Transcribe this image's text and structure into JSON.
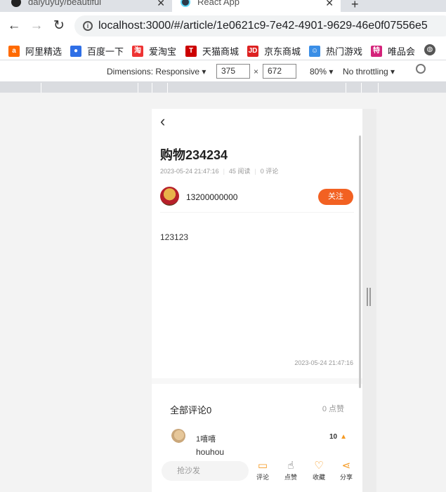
{
  "browser": {
    "tabs": [
      {
        "title": "daiyuyuy/beautiful",
        "icon": "github-icon"
      },
      {
        "title": "React App",
        "icon": "react-icon"
      }
    ],
    "url_host": "localhost",
    "url_rest": ":3000/#/article/1e0621c9-7e42-4901-9629-46e0f07556e5",
    "bookmarks": [
      "阿里精选",
      "百度一下",
      "爱淘宝",
      "天猫商城",
      "京东商城",
      "热门游戏",
      "唯品会"
    ]
  },
  "devtools": {
    "dimensions_label": "Dimensions: Responsive",
    "width": "375",
    "height": "672",
    "zoom": "80%",
    "throttling": "No throttling"
  },
  "article": {
    "title": "购物234234",
    "date": "2023-05-24 21:47:16",
    "reads": "45 阅读",
    "comments_count": "0 评论",
    "author": "13200000000",
    "follow_label": "关注",
    "content": "123123",
    "publish_time": "2023-05-24 21:47:16"
  },
  "comments_section": {
    "title": "全部评论0",
    "likes_total": "0 点赞",
    "items": [
      {
        "name": "1嘻嘻",
        "likes": "10",
        "text": "houhou"
      }
    ]
  },
  "bottom_bar": {
    "input_placeholder": "抢沙发",
    "actions": [
      "评论",
      "点赞",
      "收藏",
      "分享"
    ]
  },
  "colors": {
    "accent": "#f26122",
    "icon_orange": "#f59a23"
  }
}
